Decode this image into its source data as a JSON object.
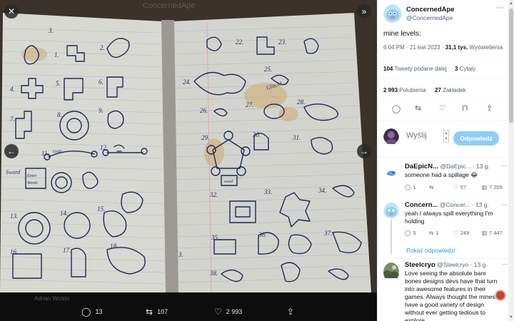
{
  "viewer": {
    "behind_title": "ConcernedApe",
    "behind_author": "Adrian Wcislo",
    "close_icon": "close-icon",
    "expand_icon": "expand-icon",
    "prev_icon": "arrow-left-icon",
    "next_icon": "arrow-right-icon",
    "notebook_labels": [
      "1.",
      "2.",
      "3.",
      "4.",
      "5.",
      "6.",
      "7.",
      "8.",
      "9.",
      "10.",
      "11.",
      "12.",
      "13.",
      "14.",
      "15.",
      "16.",
      "17.",
      "18.",
      "22.",
      "23.",
      "24.",
      "25.",
      "26.",
      "27.",
      "28.",
      "29.",
      "30.",
      "31.",
      "32.",
      "33.",
      "34.",
      "35.",
      "36.",
      "37.",
      "38."
    ],
    "notebook_words": [
      "Glitch!",
      "Sword",
      "Gold",
      "Enter Words",
      "word"
    ],
    "bar": {
      "replies": "13",
      "retweets": "107",
      "likes": "2 993"
    }
  },
  "tweet": {
    "author_name": "ConcernedApe",
    "author_handle": "@ConcernedApe",
    "text": "mine levels:",
    "time": "6:04 PM · 21 kwi 2023 ·",
    "views_count": "31,1 tys.",
    "views_label": "Wyświetlenia",
    "quote_retweets_count": "104",
    "quote_retweets_label": "Tweety podane dalej",
    "quotes_count": "3",
    "quotes_label": "Cytaty",
    "likes_count": "2 993",
    "likes_label": "Polubienia",
    "bookmarks_count": "27",
    "bookmarks_label": "Zakładek"
  },
  "composer": {
    "placeholder": "Wyślij",
    "reply_button": "Odpowiedz"
  },
  "replies": [
    {
      "name": "DaEpicN...",
      "handle": "@DaEpic...",
      "time": "· 13 g.",
      "text": "someone had a spillage 😂",
      "comments": "1",
      "retweets": "",
      "likes": "57",
      "views": "7 205"
    },
    {
      "name": "Concern...",
      "handle": "@Concer...",
      "time": "· 13 g.",
      "text": "yeah I always spill everything I'm holding",
      "comments": "5",
      "retweets": "1",
      "likes": "249",
      "views": "7 447"
    },
    {
      "name": "Steelcryo",
      "handle": "@Steelcryo",
      "time": "· 13 g.",
      "text": "Love seeing the absolute bare bones designs devs have that turn into awesome features in their games. Always thought the mines have a good variety of design without ever getting tedious to explore."
    }
  ],
  "show_replies": "Pokaż odpowiedzi",
  "colors": {
    "accent": "#1d9bf0",
    "accent_disabled": "#8ecdf8",
    "paper": "#dcdcd6",
    "ink": "#1e2a55",
    "stain": "#c9a15a"
  }
}
